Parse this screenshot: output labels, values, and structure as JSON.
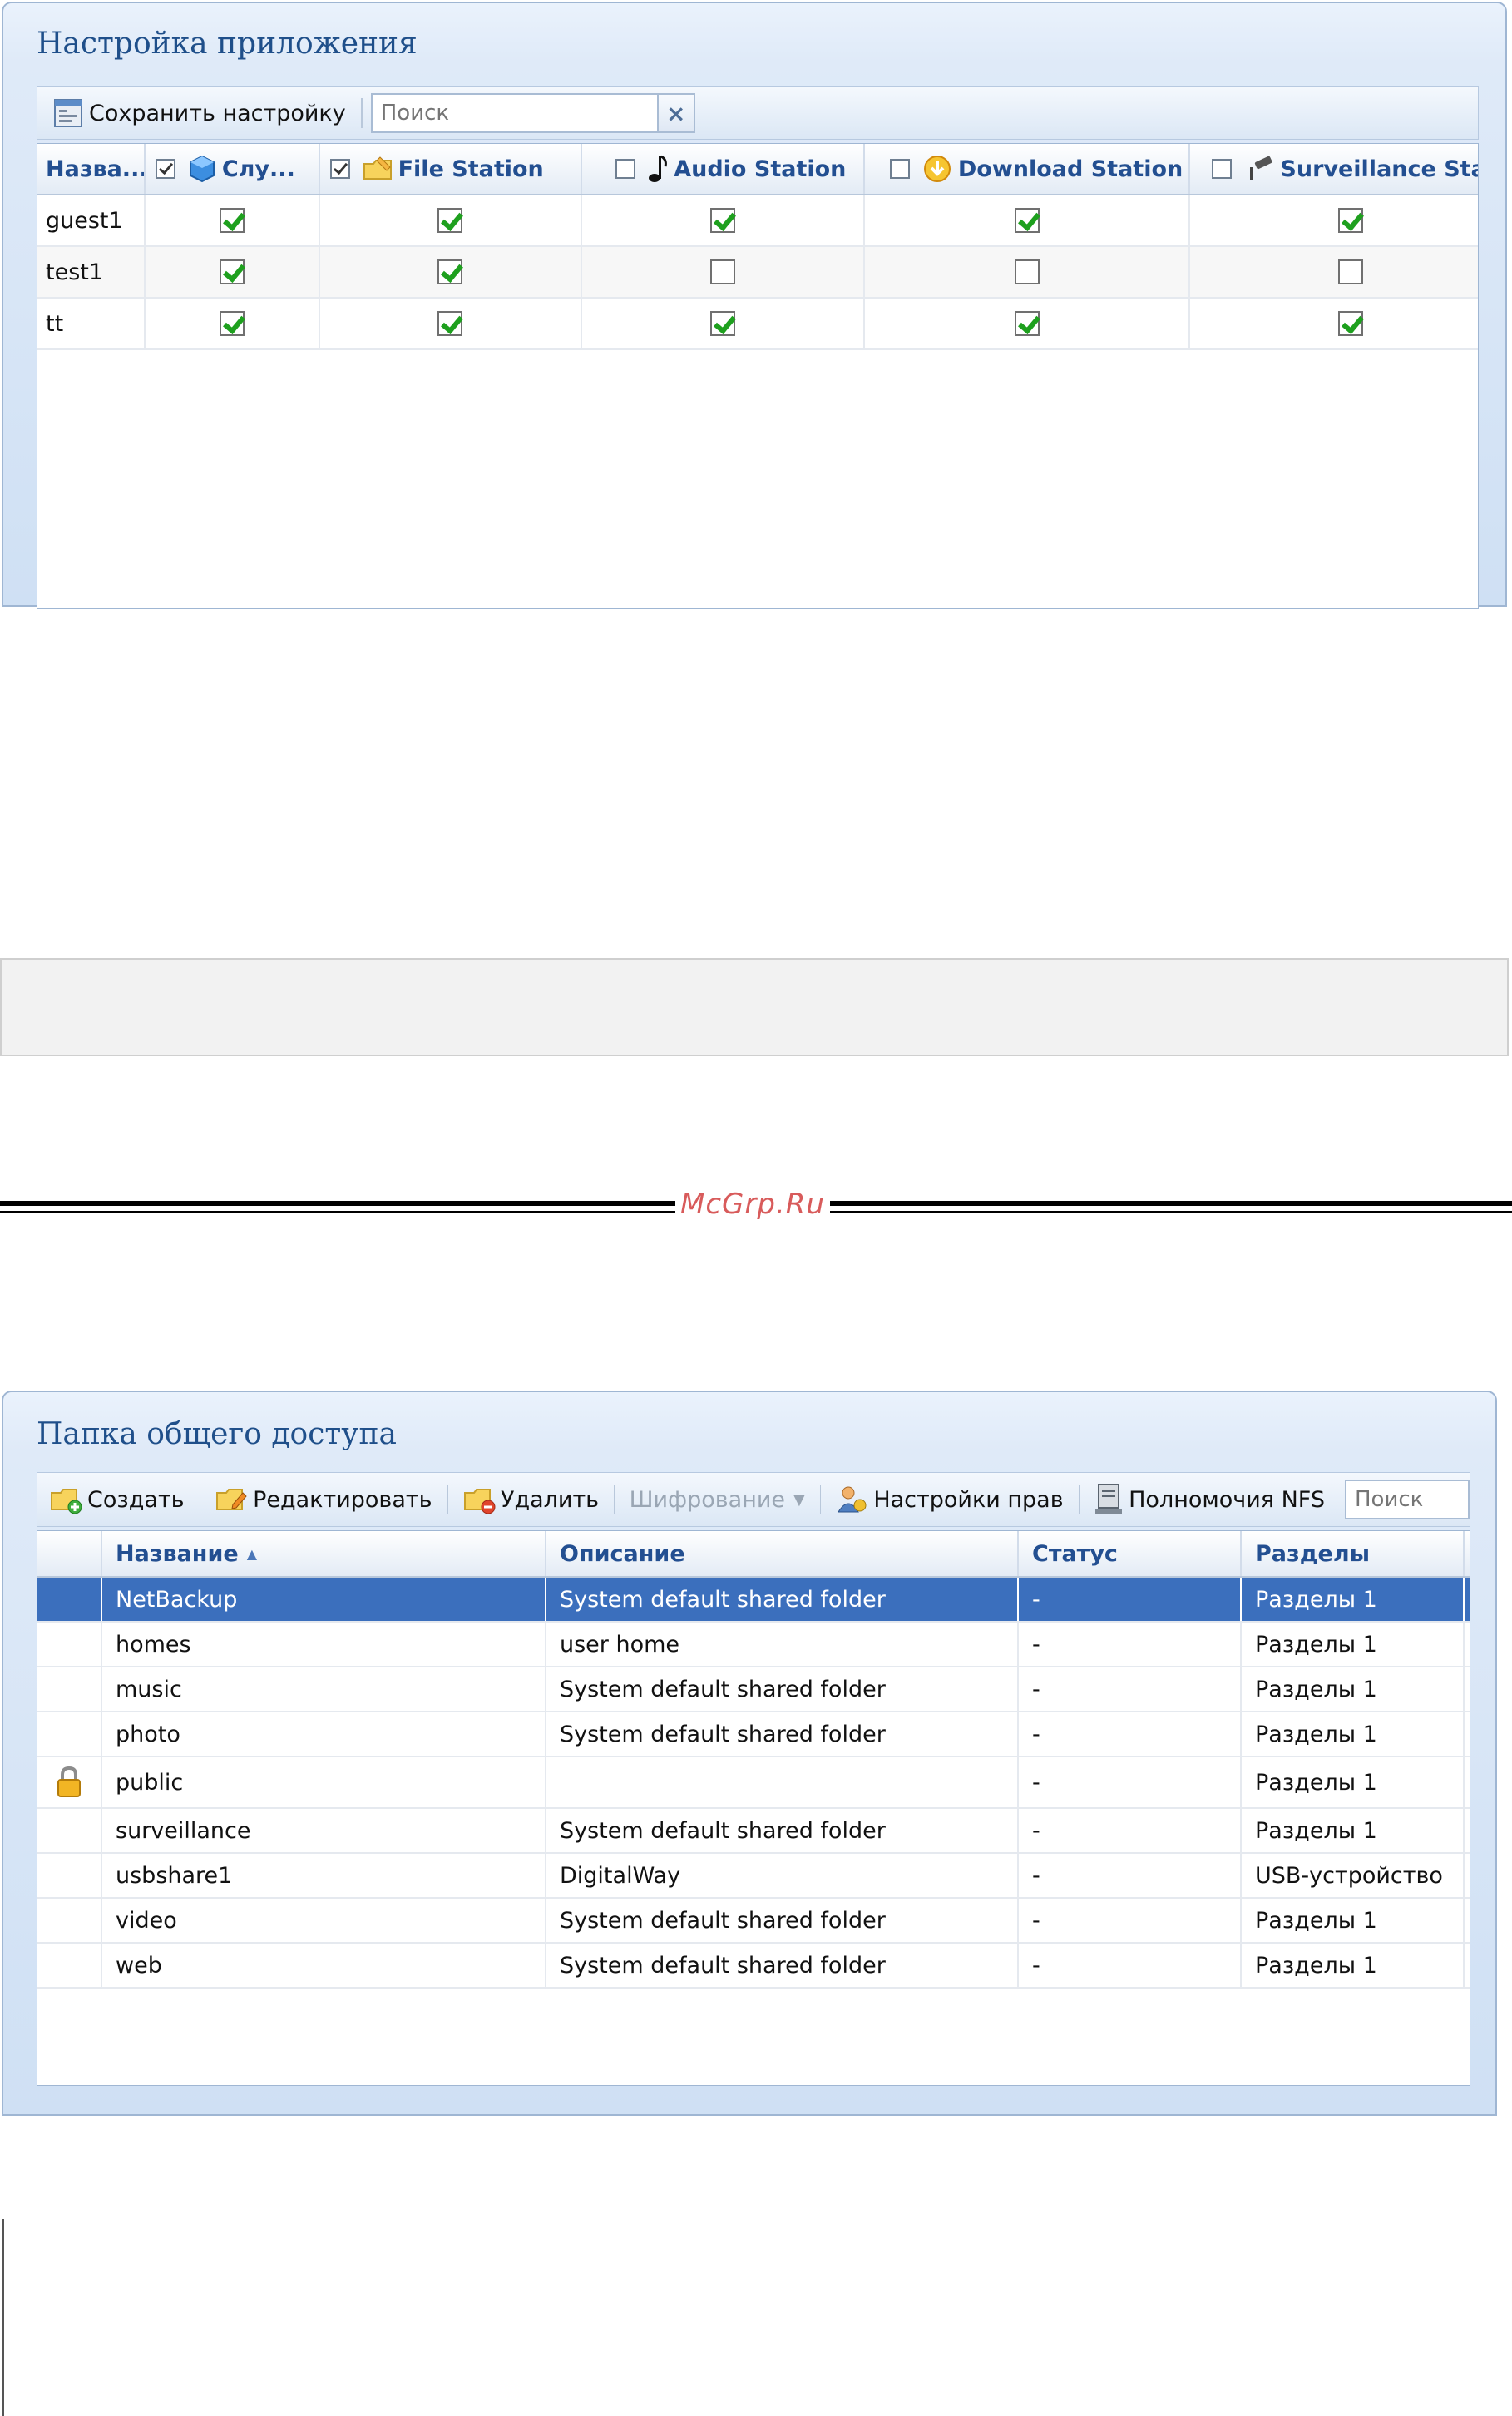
{
  "app_panel": {
    "title": "Настройка приложения",
    "save_label": "Сохранить настройку",
    "search_placeholder": "Поиск",
    "clear_symbol": "×",
    "columns": [
      {
        "label": "Назва...",
        "checked": null
      },
      {
        "label": "Слу...",
        "checked": true,
        "icon": "cube-icon"
      },
      {
        "label": "File Station",
        "checked": true,
        "icon": "folder-pencil-icon"
      },
      {
        "label": "Audio Station",
        "checked": false,
        "icon": "music-note-icon"
      },
      {
        "label": "Download Station",
        "checked": false,
        "icon": "download-badge-icon"
      },
      {
        "label": "Surveillance Sta",
        "checked": false,
        "icon": "camera-icon"
      }
    ],
    "rows": [
      {
        "name": "guest1",
        "perms": [
          true,
          true,
          true,
          true,
          true
        ]
      },
      {
        "name": "test1",
        "perms": [
          true,
          true,
          false,
          false,
          false
        ]
      },
      {
        "name": "tt",
        "perms": [
          true,
          true,
          true,
          true,
          true
        ]
      }
    ]
  },
  "watermark": "McGrp.Ru",
  "shared_panel": {
    "title": "Папка общего доступа",
    "toolbar": {
      "create": "Создать",
      "edit": "Редактировать",
      "delete": "Удалить",
      "encrypt": "Шифрование",
      "permissions": "Настройки прав",
      "nfs": "Полномочия NFS",
      "search_placeholder": "Поиск"
    },
    "columns": {
      "name": "Название",
      "description": "Описание",
      "status": "Статус",
      "volume": "Разделы"
    },
    "rows": [
      {
        "locked": false,
        "name": "NetBackup",
        "description": "System default shared folder",
        "status": "-",
        "volume": "Разделы 1",
        "selected": true
      },
      {
        "locked": false,
        "name": "homes",
        "description": "user home",
        "status": "-",
        "volume": "Разделы 1"
      },
      {
        "locked": false,
        "name": "music",
        "description": "System default shared folder",
        "status": "-",
        "volume": "Разделы 1"
      },
      {
        "locked": false,
        "name": "photo",
        "description": "System default shared folder",
        "status": "-",
        "volume": "Разделы 1"
      },
      {
        "locked": true,
        "name": "public",
        "description": "",
        "status": "-",
        "volume": "Разделы 1"
      },
      {
        "locked": false,
        "name": "surveillance",
        "description": "System default shared folder",
        "status": "-",
        "volume": "Разделы 1"
      },
      {
        "locked": false,
        "name": "usbshare1",
        "description": "DigitalWay",
        "status": "-",
        "volume": "USB-устройство"
      },
      {
        "locked": false,
        "name": "video",
        "description": "System default shared folder",
        "status": "-",
        "volume": "Разделы 1"
      },
      {
        "locked": false,
        "name": "web",
        "description": "System default shared folder",
        "status": "-",
        "volume": "Разделы 1"
      }
    ]
  }
}
